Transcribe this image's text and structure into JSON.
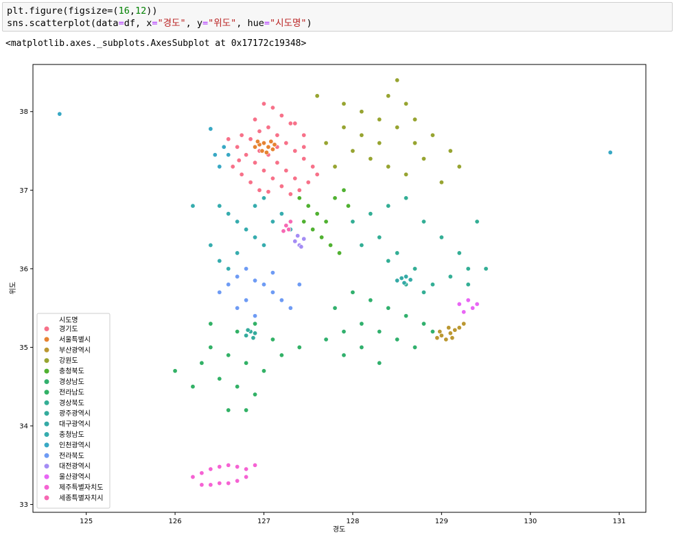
{
  "cell": {
    "line1": {
      "prefix": "plt.figure(figsize=(",
      "n1": "16",
      "comma": ",",
      "n2": "12",
      "suffix": "))"
    },
    "line2": {
      "a": "sns.scatterplot(data",
      "eq1": "=",
      "b": "df, x",
      "eq2": "=",
      "s1": "\"경도\"",
      "c": ", y",
      "eq3": "=",
      "s2": "\"위도\"",
      "d": ", hue",
      "eq4": "=",
      "s3": "\"시도명\"",
      "e": ")"
    },
    "output": "<matplotlib.axes._subplots.AxesSubplot at 0x17172c19348>"
  },
  "chart_data": {
    "type": "scatter",
    "xlabel": "경도",
    "ylabel": "위도",
    "xlim": [
      124.4,
      131.3
    ],
    "ylim": [
      32.9,
      38.6
    ],
    "xticks": [
      125,
      126,
      127,
      128,
      129,
      130,
      131
    ],
    "yticks": [
      33,
      34,
      35,
      36,
      37,
      38
    ],
    "grid": false,
    "legend_title": "시도명",
    "legend_position": "lower-left",
    "series": [
      {
        "name": "경기도",
        "color": "#f77189",
        "points": [
          [
            126.75,
            37.7
          ],
          [
            126.85,
            37.65
          ],
          [
            126.95,
            37.75
          ],
          [
            127.05,
            37.8
          ],
          [
            127.15,
            37.7
          ],
          [
            127.25,
            37.6
          ],
          [
            127.35,
            37.5
          ],
          [
            127.45,
            37.4
          ],
          [
            127.55,
            37.3
          ],
          [
            127.6,
            37.2
          ],
          [
            127.5,
            37.1
          ],
          [
            127.4,
            37.0
          ],
          [
            127.3,
            36.95
          ],
          [
            127.2,
            37.05
          ],
          [
            127.1,
            37.15
          ],
          [
            127.0,
            37.25
          ],
          [
            126.9,
            37.35
          ],
          [
            126.8,
            37.45
          ],
          [
            126.7,
            37.55
          ],
          [
            126.65,
            37.3
          ],
          [
            126.75,
            37.2
          ],
          [
            126.85,
            37.1
          ],
          [
            126.95,
            37.0
          ],
          [
            127.05,
            36.98
          ],
          [
            127.15,
            37.35
          ],
          [
            127.25,
            37.25
          ],
          [
            127.35,
            37.15
          ],
          [
            127.45,
            37.7
          ],
          [
            127.3,
            37.85
          ],
          [
            127.2,
            37.95
          ],
          [
            127.1,
            38.05
          ],
          [
            127.0,
            38.1
          ],
          [
            126.9,
            37.9
          ],
          [
            126.95,
            37.5
          ],
          [
            127.05,
            37.45
          ],
          [
            127.35,
            37.85
          ],
          [
            127.45,
            37.55
          ],
          [
            126.6,
            37.65
          ],
          [
            126.72,
            37.38
          ],
          [
            127.15,
            37.55
          ]
        ]
      },
      {
        "name": "서울특별시",
        "color": "#e68332",
        "points": [
          [
            126.9,
            37.55
          ],
          [
            126.95,
            37.58
          ],
          [
            127.0,
            37.6
          ],
          [
            127.05,
            37.55
          ],
          [
            127.1,
            37.52
          ],
          [
            126.98,
            37.5
          ],
          [
            127.03,
            37.48
          ],
          [
            126.93,
            37.62
          ],
          [
            127.08,
            37.62
          ],
          [
            127.12,
            37.58
          ]
        ]
      },
      {
        "name": "부산광역시",
        "color": "#bb9832",
        "points": [
          [
            128.95,
            35.12
          ],
          [
            129.0,
            35.15
          ],
          [
            129.05,
            35.1
          ],
          [
            129.1,
            35.18
          ],
          [
            129.15,
            35.22
          ],
          [
            129.2,
            35.25
          ],
          [
            129.25,
            35.3
          ],
          [
            128.98,
            35.2
          ],
          [
            129.08,
            35.25
          ],
          [
            129.12,
            35.12
          ]
        ]
      },
      {
        "name": "강원도",
        "color": "#97a431",
        "points": [
          [
            127.7,
            37.6
          ],
          [
            127.9,
            37.8
          ],
          [
            128.1,
            37.7
          ],
          [
            128.3,
            37.6
          ],
          [
            128.5,
            37.8
          ],
          [
            128.7,
            37.9
          ],
          [
            128.9,
            37.7
          ],
          [
            129.1,
            37.5
          ],
          [
            129.2,
            37.3
          ],
          [
            128.8,
            37.4
          ],
          [
            128.6,
            37.2
          ],
          [
            128.4,
            37.3
          ],
          [
            128.2,
            37.4
          ],
          [
            128.0,
            37.5
          ],
          [
            127.8,
            37.3
          ],
          [
            128.4,
            38.2
          ],
          [
            128.5,
            38.4
          ],
          [
            128.6,
            38.1
          ],
          [
            128.3,
            37.9
          ],
          [
            127.9,
            38.1
          ],
          [
            127.6,
            38.2
          ],
          [
            128.1,
            38.0
          ],
          [
            129.0,
            37.1
          ],
          [
            128.7,
            37.6
          ]
        ]
      },
      {
        "name": "충청북도",
        "color": "#50b131",
        "points": [
          [
            127.4,
            36.9
          ],
          [
            127.5,
            36.8
          ],
          [
            127.6,
            36.7
          ],
          [
            127.7,
            36.6
          ],
          [
            127.8,
            36.9
          ],
          [
            127.9,
            37.0
          ],
          [
            127.65,
            36.4
          ],
          [
            127.75,
            36.3
          ],
          [
            127.85,
            36.2
          ],
          [
            127.55,
            36.5
          ],
          [
            127.95,
            36.8
          ],
          [
            127.45,
            36.6
          ]
        ]
      },
      {
        "name": "경상남도",
        "color": "#31b06d",
        "points": [
          [
            127.7,
            35.1
          ],
          [
            127.9,
            35.2
          ],
          [
            128.1,
            35.3
          ],
          [
            128.3,
            35.2
          ],
          [
            128.5,
            35.1
          ],
          [
            128.7,
            35.0
          ],
          [
            128.6,
            35.4
          ],
          [
            128.4,
            35.5
          ],
          [
            128.2,
            35.6
          ],
          [
            128.0,
            35.7
          ],
          [
            127.8,
            35.5
          ],
          [
            128.8,
            35.3
          ],
          [
            128.9,
            35.2
          ],
          [
            127.9,
            34.9
          ],
          [
            128.3,
            34.8
          ],
          [
            128.1,
            35.0
          ]
        ]
      },
      {
        "name": "전라남도",
        "color": "#32b166",
        "points": [
          [
            126.4,
            35.0
          ],
          [
            126.6,
            34.9
          ],
          [
            126.8,
            34.8
          ],
          [
            127.0,
            34.7
          ],
          [
            127.2,
            34.9
          ],
          [
            127.4,
            35.0
          ],
          [
            126.5,
            34.6
          ],
          [
            126.7,
            34.5
          ],
          [
            126.9,
            34.4
          ],
          [
            126.3,
            34.8
          ],
          [
            126.2,
            34.5
          ],
          [
            126.6,
            34.2
          ],
          [
            126.8,
            34.2
          ],
          [
            127.1,
            35.1
          ],
          [
            126.0,
            34.7
          ],
          [
            126.4,
            35.3
          ],
          [
            126.7,
            35.2
          ],
          [
            126.9,
            35.3
          ]
        ]
      },
      {
        "name": "경상북도",
        "color": "#33ae95",
        "points": [
          [
            128.0,
            36.6
          ],
          [
            128.2,
            36.7
          ],
          [
            128.4,
            36.8
          ],
          [
            128.6,
            36.9
          ],
          [
            128.8,
            36.6
          ],
          [
            129.0,
            36.4
          ],
          [
            129.2,
            36.2
          ],
          [
            129.3,
            36.0
          ],
          [
            129.1,
            35.9
          ],
          [
            128.9,
            35.8
          ],
          [
            128.7,
            36.0
          ],
          [
            128.5,
            36.2
          ],
          [
            128.3,
            36.4
          ],
          [
            128.1,
            36.3
          ],
          [
            129.4,
            36.6
          ],
          [
            129.5,
            36.0
          ],
          [
            128.6,
            35.8
          ],
          [
            128.8,
            35.7
          ],
          [
            129.3,
            35.8
          ],
          [
            128.4,
            36.1
          ]
        ]
      },
      {
        "name": "광주광역시",
        "color": "#34ab9c",
        "points": [
          [
            126.8,
            35.15
          ],
          [
            126.85,
            35.2
          ],
          [
            126.9,
            35.18
          ],
          [
            126.88,
            35.12
          ],
          [
            126.82,
            35.22
          ]
        ]
      },
      {
        "name": "대구광역시",
        "color": "#35aaa6",
        "points": [
          [
            128.5,
            35.85
          ],
          [
            128.55,
            35.88
          ],
          [
            128.6,
            35.9
          ],
          [
            128.65,
            35.86
          ],
          [
            128.58,
            35.82
          ]
        ]
      },
      {
        "name": "충청남도",
        "color": "#36acae",
        "points": [
          [
            126.5,
            36.8
          ],
          [
            126.6,
            36.7
          ],
          [
            126.7,
            36.6
          ],
          [
            126.8,
            36.5
          ],
          [
            126.9,
            36.4
          ],
          [
            127.0,
            36.3
          ],
          [
            127.1,
            36.6
          ],
          [
            127.2,
            36.7
          ],
          [
            127.3,
            36.5
          ],
          [
            126.4,
            36.3
          ],
          [
            126.5,
            36.1
          ],
          [
            126.6,
            36.0
          ],
          [
            126.7,
            36.2
          ],
          [
            126.9,
            36.8
          ],
          [
            127.0,
            36.9
          ],
          [
            126.2,
            36.8
          ]
        ]
      },
      {
        "name": "인천광역시",
        "color": "#38a8c4",
        "points": [
          [
            124.7,
            37.97
          ],
          [
            126.4,
            37.78
          ],
          [
            126.45,
            37.45
          ],
          [
            126.6,
            37.45
          ],
          [
            126.55,
            37.55
          ],
          [
            126.5,
            37.3
          ],
          [
            130.9,
            37.48
          ]
        ]
      },
      {
        "name": "전라북도",
        "color": "#6e9bf4",
        "points": [
          [
            126.6,
            35.8
          ],
          [
            126.7,
            35.9
          ],
          [
            126.8,
            36.0
          ],
          [
            126.9,
            35.85
          ],
          [
            127.0,
            35.8
          ],
          [
            127.1,
            35.7
          ],
          [
            127.2,
            35.6
          ],
          [
            127.3,
            35.5
          ],
          [
            126.7,
            35.5
          ],
          [
            126.8,
            35.6
          ],
          [
            126.9,
            35.4
          ],
          [
            127.4,
            35.8
          ],
          [
            126.5,
            35.7
          ],
          [
            127.1,
            35.95
          ]
        ]
      },
      {
        "name": "대전광역시",
        "color": "#a48cf4",
        "points": [
          [
            127.35,
            36.35
          ],
          [
            127.4,
            36.3
          ],
          [
            127.45,
            36.38
          ],
          [
            127.38,
            36.42
          ],
          [
            127.42,
            36.28
          ]
        ]
      },
      {
        "name": "울산광역시",
        "color": "#e866f4",
        "points": [
          [
            129.2,
            35.55
          ],
          [
            129.3,
            35.6
          ],
          [
            129.35,
            35.5
          ],
          [
            129.25,
            35.45
          ],
          [
            129.4,
            35.55
          ]
        ]
      },
      {
        "name": "제주특별자치도",
        "color": "#f563d3",
        "points": [
          [
            126.2,
            33.35
          ],
          [
            126.3,
            33.4
          ],
          [
            126.4,
            33.45
          ],
          [
            126.5,
            33.48
          ],
          [
            126.6,
            33.5
          ],
          [
            126.7,
            33.48
          ],
          [
            126.8,
            33.45
          ],
          [
            126.9,
            33.5
          ],
          [
            126.3,
            33.25
          ],
          [
            126.4,
            33.25
          ],
          [
            126.5,
            33.27
          ],
          [
            126.6,
            33.27
          ],
          [
            126.7,
            33.3
          ],
          [
            126.8,
            33.35
          ]
        ]
      },
      {
        "name": "세종특별자치시",
        "color": "#f668b3",
        "points": [
          [
            127.25,
            36.55
          ],
          [
            127.28,
            36.5
          ],
          [
            127.22,
            36.48
          ],
          [
            127.3,
            36.6
          ]
        ]
      }
    ]
  }
}
